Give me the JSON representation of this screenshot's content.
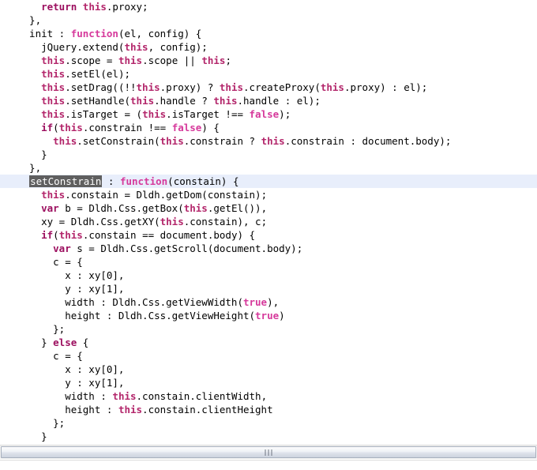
{
  "editor": {
    "language": "javascript",
    "current_line_index": 13,
    "selection_text": "setConstrain",
    "colors": {
      "background": "#ffffff",
      "text": "#000000",
      "keyword": "#9c0f5f",
      "this_keyword": "#b3266b",
      "function_keyword": "#d6399b",
      "boolean": "#d6399b",
      "current_line_highlight": "#e8eefb",
      "selection_background": "#5f5f5f",
      "selection_text": "#ffffff"
    },
    "lines": [
      "    return this.proxy;",
      "  },",
      "  init : function(el, config) {",
      "    jQuery.extend(this, config);",
      "    this.scope = this.scope || this;",
      "    this.setEl(el);",
      "    this.setDrag((!!this.proxy) ? this.createProxy(this.proxy) : el);",
      "    this.setHandle(this.handle ? this.handle : el);",
      "    this.isTarget = (this.isTarget !== false);",
      "    if(this.constrain !== false) {",
      "      this.setConstrain(this.constrain ? this.constrain : document.body);",
      "    }",
      "  },",
      "  setConstrain : function(constain) {",
      "    this.constain = Dldh.getDom(constain);",
      "    var b = Dldh.Css.getBox(this.getEl()),",
      "    xy = Dldh.Css.getXY(this.constain), c;",
      "    if(this.constain == document.body) {",
      "      var s = Dldh.Css.getScroll(document.body);",
      "      c = {",
      "        x : xy[0],",
      "        y : xy[1],",
      "        width : Dldh.Css.getViewWidth(true),",
      "        height : Dldh.Css.getViewHeight(true)",
      "      };",
      "    } else {",
      "      c = {",
      "        x : xy[0],",
      "        y : xy[1],",
      "        width : this.constain.clientWidth,",
      "        height : this.constain.clientHeight",
      "      };",
      "    }"
    ],
    "tokens": [
      [
        [
          "    ",
          "plain"
        ],
        [
          "return",
          "kw"
        ],
        [
          " ",
          "plain"
        ],
        [
          "this",
          "this"
        ],
        [
          ".proxy;",
          "plain"
        ]
      ],
      [
        [
          "  },",
          "plain"
        ]
      ],
      [
        [
          "  init : ",
          "plain"
        ],
        [
          "function",
          "fn"
        ],
        [
          "(el, config) {",
          "plain"
        ]
      ],
      [
        [
          "    jQuery.extend(",
          "plain"
        ],
        [
          "this",
          "this"
        ],
        [
          ", config);",
          "plain"
        ]
      ],
      [
        [
          "    ",
          "plain"
        ],
        [
          "this",
          "this"
        ],
        [
          ".scope = ",
          "plain"
        ],
        [
          "this",
          "this"
        ],
        [
          ".scope || ",
          "plain"
        ],
        [
          "this",
          "this"
        ],
        [
          ";",
          "plain"
        ]
      ],
      [
        [
          "    ",
          "plain"
        ],
        [
          "this",
          "this"
        ],
        [
          ".setEl(el);",
          "plain"
        ]
      ],
      [
        [
          "    ",
          "plain"
        ],
        [
          "this",
          "this"
        ],
        [
          ".setDrag((!!",
          "plain"
        ],
        [
          "this",
          "this"
        ],
        [
          ".proxy) ? ",
          "plain"
        ],
        [
          "this",
          "this"
        ],
        [
          ".createProxy(",
          "plain"
        ],
        [
          "this",
          "this"
        ],
        [
          ".proxy) : el);",
          "plain"
        ]
      ],
      [
        [
          "    ",
          "plain"
        ],
        [
          "this",
          "this"
        ],
        [
          ".setHandle(",
          "plain"
        ],
        [
          "this",
          "this"
        ],
        [
          ".handle ? ",
          "plain"
        ],
        [
          "this",
          "this"
        ],
        [
          ".handle : el);",
          "plain"
        ]
      ],
      [
        [
          "    ",
          "plain"
        ],
        [
          "this",
          "this"
        ],
        [
          ".isTarget = (",
          "plain"
        ],
        [
          "this",
          "this"
        ],
        [
          ".isTarget !== ",
          "plain"
        ],
        [
          "false",
          "bool"
        ],
        [
          ");",
          "plain"
        ]
      ],
      [
        [
          "    ",
          "plain"
        ],
        [
          "if",
          "kw"
        ],
        [
          "(",
          "plain"
        ],
        [
          "this",
          "this"
        ],
        [
          ".constrain !== ",
          "plain"
        ],
        [
          "false",
          "bool"
        ],
        [
          ") {",
          "plain"
        ]
      ],
      [
        [
          "      ",
          "plain"
        ],
        [
          "this",
          "this"
        ],
        [
          ".setConstrain(",
          "plain"
        ],
        [
          "this",
          "this"
        ],
        [
          ".constrain ? ",
          "plain"
        ],
        [
          "this",
          "this"
        ],
        [
          ".constrain : document.body);",
          "plain"
        ]
      ],
      [
        [
          "    }",
          "plain"
        ]
      ],
      [
        [
          "  },",
          "plain"
        ]
      ],
      [
        [
          "  ",
          "plain"
        ],
        [
          "setConstrain",
          "sel"
        ],
        [
          " : ",
          "plain"
        ],
        [
          "function",
          "fn"
        ],
        [
          "(constain) {",
          "plain"
        ]
      ],
      [
        [
          "    ",
          "plain"
        ],
        [
          "this",
          "this"
        ],
        [
          ".constain = Dldh.getDom(constain);",
          "plain"
        ]
      ],
      [
        [
          "    ",
          "plain"
        ],
        [
          "var",
          "kw"
        ],
        [
          " b = Dldh.Css.getBox(",
          "plain"
        ],
        [
          "this",
          "this"
        ],
        [
          ".getEl()),",
          "plain"
        ]
      ],
      [
        [
          "    xy = Dldh.Css.getXY(",
          "plain"
        ],
        [
          "this",
          "this"
        ],
        [
          ".constain), c;",
          "plain"
        ]
      ],
      [
        [
          "    ",
          "plain"
        ],
        [
          "if",
          "kw"
        ],
        [
          "(",
          "plain"
        ],
        [
          "this",
          "this"
        ],
        [
          ".constain == document.body) {",
          "plain"
        ]
      ],
      [
        [
          "      ",
          "plain"
        ],
        [
          "var",
          "kw"
        ],
        [
          " s = Dldh.Css.getScroll(document.body);",
          "plain"
        ]
      ],
      [
        [
          "      c = {",
          "plain"
        ]
      ],
      [
        [
          "        x : xy[0],",
          "plain"
        ]
      ],
      [
        [
          "        y : xy[1],",
          "plain"
        ]
      ],
      [
        [
          "        width : Dldh.Css.getViewWidth(",
          "plain"
        ],
        [
          "true",
          "bool"
        ],
        [
          "),",
          "plain"
        ]
      ],
      [
        [
          "        height : Dldh.Css.getViewHeight(",
          "plain"
        ],
        [
          "true",
          "bool"
        ],
        [
          ")",
          "plain"
        ]
      ],
      [
        [
          "      };",
          "plain"
        ]
      ],
      [
        [
          "    } ",
          "plain"
        ],
        [
          "else",
          "kw"
        ],
        [
          " {",
          "plain"
        ]
      ],
      [
        [
          "      c = {",
          "plain"
        ]
      ],
      [
        [
          "        x : xy[0],",
          "plain"
        ]
      ],
      [
        [
          "        y : xy[1],",
          "plain"
        ]
      ],
      [
        [
          "        width : ",
          "plain"
        ],
        [
          "this",
          "this"
        ],
        [
          ".constain.clientWidth,",
          "plain"
        ]
      ],
      [
        [
          "        height : ",
          "plain"
        ],
        [
          "this",
          "this"
        ],
        [
          ".constain.clientHeight",
          "plain"
        ]
      ],
      [
        [
          "      };",
          "plain"
        ]
      ],
      [
        [
          "    }",
          "plain"
        ]
      ]
    ]
  },
  "scrollbar": {
    "orientation": "horizontal",
    "thumb_position_percent": 0,
    "thumb_width_percent": 100,
    "grip_marks": 3
  }
}
